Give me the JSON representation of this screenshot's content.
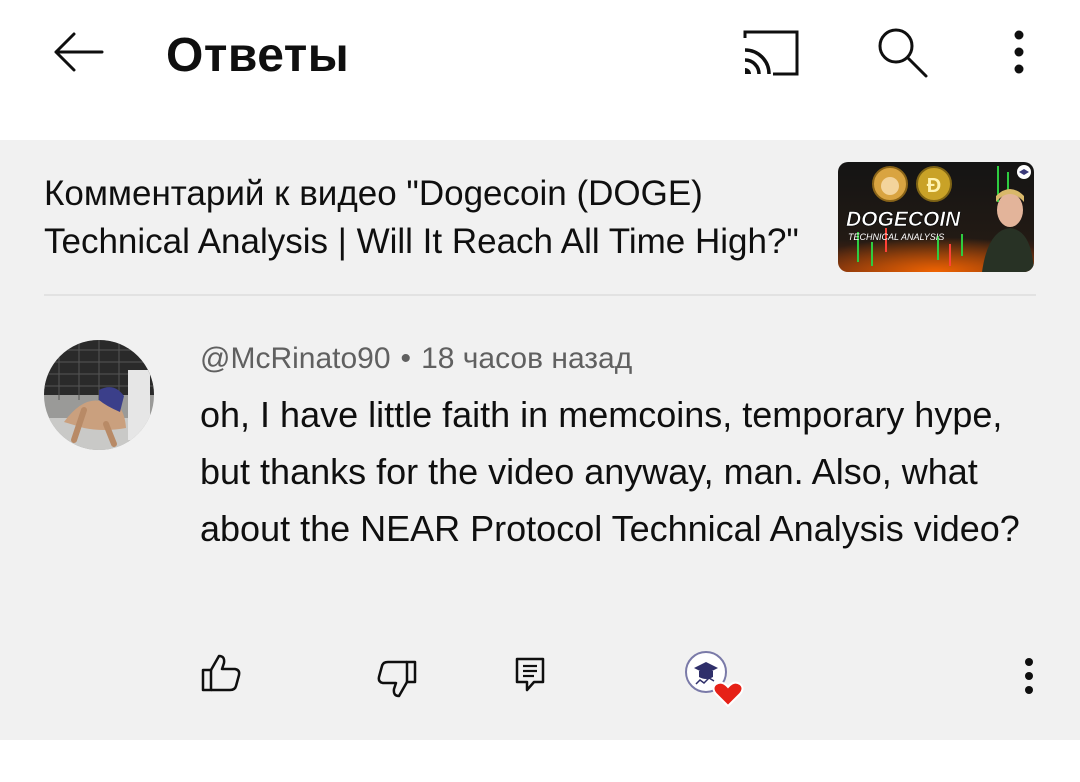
{
  "header": {
    "title": "Ответы",
    "icons": [
      "arrow-back-icon",
      "cast-icon",
      "search-icon",
      "more-vert-icon"
    ]
  },
  "video_context": {
    "text": "Комментарий к видео \"Dogecoin (DOGE) Technical Analysis | Will It Reach All Time High?\"",
    "thumbnail": {
      "title": "DOGECOIN",
      "subtitle": "TECHNICAL ANALYSIS"
    }
  },
  "comment": {
    "author": "@McRinato90",
    "separator": "•",
    "time": "18 часов назад",
    "text": "oh, I have little faith in memcoins, temporary hype, but thanks for the video anyway, man. Also, what about the NEAR Protocol Technical Analysis video?",
    "actions": [
      "like-icon",
      "dislike-icon",
      "reply-icon",
      "creator-heart-icon",
      "more-vert-icon"
    ]
  },
  "colors": {
    "background": "#ffffff",
    "panel": "#f1f1f1",
    "secondary_text": "#606060",
    "heart": "#e62117"
  }
}
